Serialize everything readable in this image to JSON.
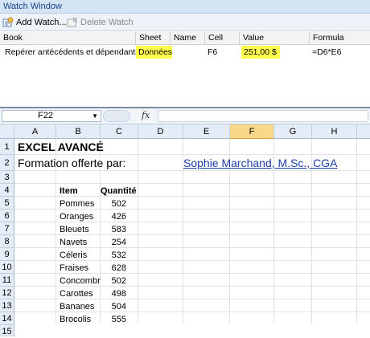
{
  "watch_window": {
    "title": "Watch Window",
    "toolbar": {
      "add_label": "Add Watch...",
      "delete_label": "Delete Watch"
    },
    "columns": [
      "Book",
      "Sheet",
      "Name",
      "Cell",
      "Value",
      "Formula"
    ],
    "row": {
      "book": "Repérer antécédents et dépendants.xlsx",
      "sheet": "Données",
      "name": "",
      "cell": "F6",
      "value": "251,00  $",
      "formula": "=D6*E6"
    }
  },
  "formula_bar": {
    "name_box": "F22",
    "fx_label": "fx",
    "formula": ""
  },
  "sheet": {
    "columns": [
      "A",
      "B",
      "C",
      "D",
      "E",
      "F",
      "G",
      "H"
    ],
    "selected_column": "F",
    "rows": [
      "1",
      "2",
      "3",
      "4",
      "5",
      "6",
      "7",
      "8",
      "9",
      "10",
      "11",
      "12",
      "13",
      "14",
      "15"
    ],
    "title": "EXCEL AVANCÉ",
    "subtitle": "Formation offerte par:",
    "author_link": "Sophie Marchand, M.Sc., CGA",
    "table_headers": {
      "item": "Item",
      "quantity": "Quantité"
    },
    "items": [
      {
        "item": "Pommes",
        "qty": "502"
      },
      {
        "item": "Oranges",
        "qty": "426"
      },
      {
        "item": "Bleuets",
        "qty": "583"
      },
      {
        "item": "Navets",
        "qty": "254"
      },
      {
        "item": "Céleris",
        "qty": "532"
      },
      {
        "item": "Fraises",
        "qty": "628"
      },
      {
        "item": "Concombre",
        "qty": "502"
      },
      {
        "item": "Carottes",
        "qty": "498"
      },
      {
        "item": "Bananes",
        "qty": "504"
      },
      {
        "item": "Brocolis",
        "qty": "555"
      }
    ]
  },
  "colors": {
    "highlight": "#ffff4d",
    "link": "#1c3ea8",
    "header_bg": "#e4ecf7",
    "selected_header": "#f8d889"
  }
}
